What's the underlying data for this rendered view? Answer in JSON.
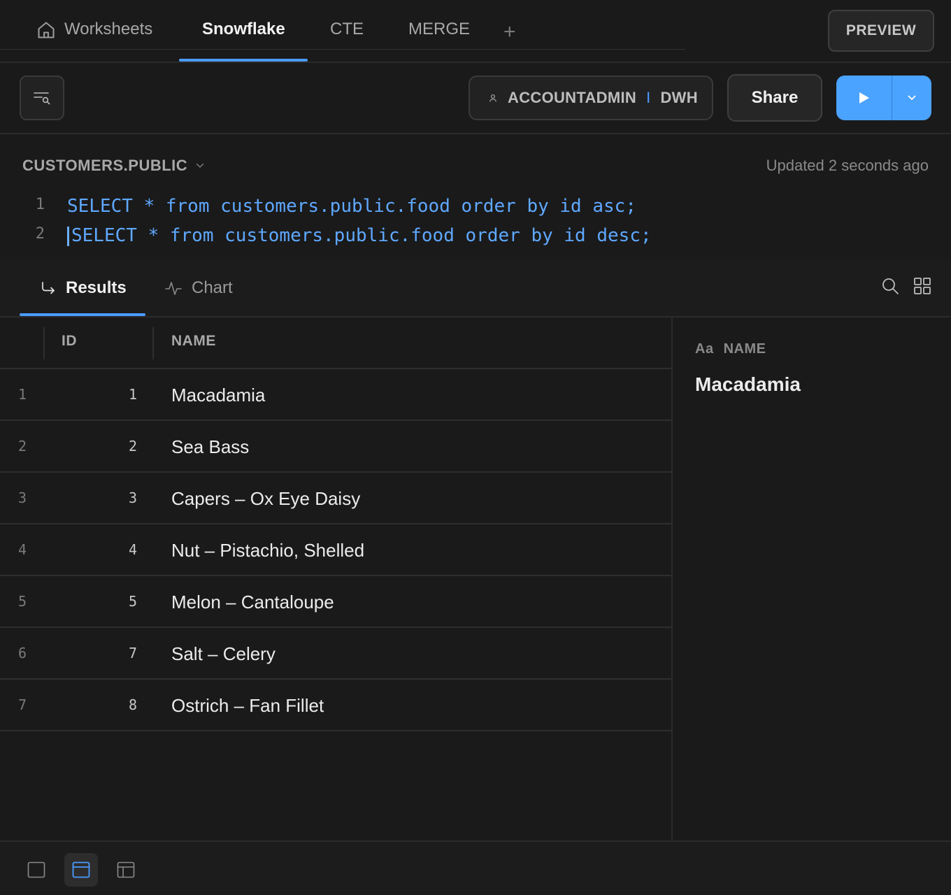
{
  "top_tabs": [
    {
      "label": "Worksheets",
      "icon": "home-icon"
    },
    {
      "label": "Snowflake",
      "active": true
    },
    {
      "label": "CTE"
    },
    {
      "label": "MERGE"
    }
  ],
  "new_tab_label": "+",
  "preview_label": "PREVIEW",
  "toolbar": {
    "role": "ACCOUNTADMIN",
    "role_separator": "I",
    "warehouse": "DWH",
    "share_label": "Share",
    "run_color": "#4aa3ff"
  },
  "editor": {
    "schema": "CUSTOMERS.PUBLIC",
    "updated": "Updated 2 seconds ago",
    "lines": [
      {
        "no": "1",
        "code": "SELECT * from customers.public.food order by id asc;"
      },
      {
        "no": "2",
        "code": "SELECT * from customers.public.food order by id desc;"
      }
    ]
  },
  "result_tabs": [
    {
      "label": "Results",
      "active": true
    },
    {
      "label": "Chart"
    }
  ],
  "table": {
    "columns": [
      "ID",
      "NAME"
    ],
    "rows": [
      {
        "rn": "1",
        "id": "1",
        "name": "Macadamia"
      },
      {
        "rn": "2",
        "id": "2",
        "name": "Sea Bass"
      },
      {
        "rn": "3",
        "id": "3",
        "name": "Capers – Ox Eye Daisy"
      },
      {
        "rn": "4",
        "id": "4",
        "name": "Nut – Pistachio, Shelled"
      },
      {
        "rn": "5",
        "id": "5",
        "name": "Melon – Cantaloupe"
      },
      {
        "rn": "6",
        "id": "7",
        "name": "Salt – Celery"
      },
      {
        "rn": "7",
        "id": "8",
        "name": "Ostrich – Fan Fillet"
      }
    ]
  },
  "detail": {
    "type_label": "Aa",
    "column": "NAME",
    "value": "Macadamia"
  },
  "accent_color": "#4a9bff"
}
